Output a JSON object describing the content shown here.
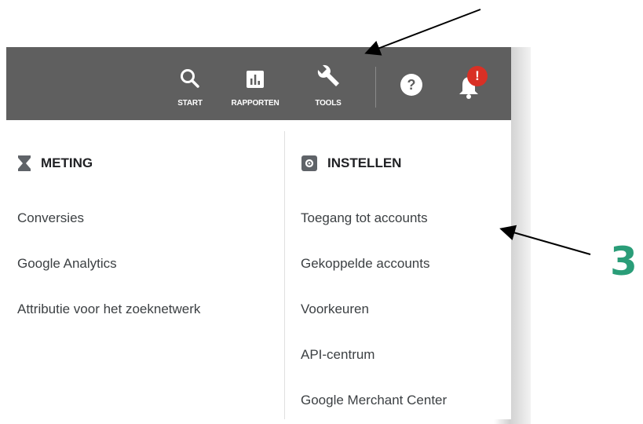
{
  "toolbar": {
    "start_label": "START",
    "reports_label": "RAPPORTEN",
    "tools_label": "TOOLS",
    "notification_badge": "!"
  },
  "menu": {
    "meting": {
      "title": "METING",
      "items": [
        "Conversies",
        "Google Analytics",
        "Attributie voor het zoeknetwerk"
      ]
    },
    "instellen": {
      "title": "INSTELLEN",
      "items": [
        "Toegang tot accounts",
        "Gekoppelde accounts",
        "Voorkeuren",
        "API-centrum",
        "Google Merchant Center"
      ]
    }
  },
  "annotation": {
    "step_number": "3"
  },
  "colors": {
    "toolbar_bg": "#5f5f5f",
    "badge": "#d93025",
    "step_number": "#2a9d78"
  }
}
